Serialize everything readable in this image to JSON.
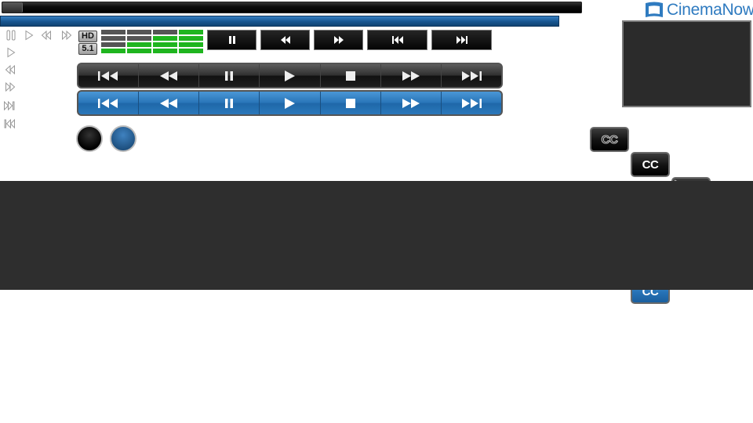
{
  "logo": {
    "text": "CinemaNow",
    "tm": "™",
    "icon": "cinemanow-screen-icon",
    "color": "#2f7bc0"
  },
  "badges": {
    "hd": "HD",
    "audio": "5.1"
  },
  "mini_icons": [
    "pause-outline-icon",
    "play-outline-icon",
    "rewind-outline-icon",
    "fast-forward-outline-icon",
    "play-outline-icon",
    "rewind-outline-icon",
    "fast-forward-outline-icon",
    "skip-forward-outline-icon",
    "skip-back-outline-icon"
  ],
  "small_buttons": [
    "pause-icon",
    "rewind-icon",
    "fast-forward-icon",
    "skip-back-icon",
    "skip-forward-icon"
  ],
  "transport_icons": [
    "skip-back-icon",
    "rewind-icon",
    "pause-icon",
    "play-icon",
    "stop-icon",
    "fast-forward-icon",
    "skip-forward-icon"
  ],
  "cc": {
    "label": "CC"
  },
  "colors": {
    "accent_blue": "#2874b8",
    "meter_green": "#1fb51f",
    "meter_gray": "#555555",
    "panel_dark": "#2e2e2e"
  }
}
